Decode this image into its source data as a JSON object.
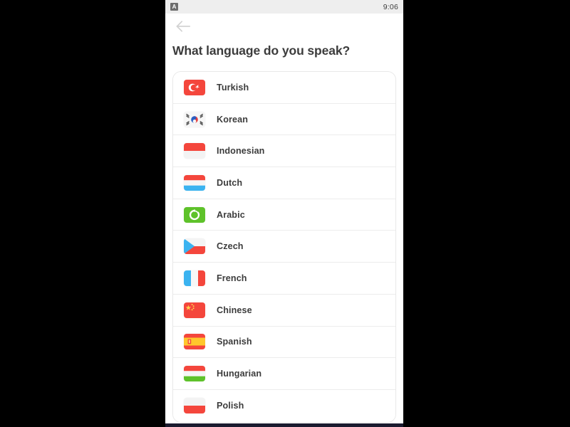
{
  "status_bar": {
    "app_icon": "app-badge-icon",
    "app_icon_glyph": "A",
    "time": "9:06"
  },
  "nav": {
    "back_icon": "back-arrow-icon"
  },
  "page": {
    "title": "What language do you speak?"
  },
  "colors": {
    "page_background": "#000000",
    "screen_background": "#ffffff",
    "status_bar_background": "#eeeeee",
    "text_primary": "#3c3c3c",
    "divider": "#ececec",
    "card_border": "#e8e8e8",
    "flag_red": "#f4463c",
    "flag_green": "#5ec22a",
    "flag_blue": "#3bb3f0",
    "flag_yellow": "#ffc72c"
  },
  "languages": [
    {
      "label": "Turkish",
      "flag": "flag-turkey-icon"
    },
    {
      "label": "Korean",
      "flag": "flag-south-korea-icon"
    },
    {
      "label": "Indonesian",
      "flag": "flag-indonesia-icon"
    },
    {
      "label": "Dutch",
      "flag": "flag-netherlands-icon"
    },
    {
      "label": "Arabic",
      "flag": "flag-arabic-icon"
    },
    {
      "label": "Czech",
      "flag": "flag-czech-republic-icon"
    },
    {
      "label": "French",
      "flag": "flag-france-icon"
    },
    {
      "label": "Chinese",
      "flag": "flag-china-icon"
    },
    {
      "label": "Spanish",
      "flag": "flag-spain-icon"
    },
    {
      "label": "Hungarian",
      "flag": "flag-hungary-icon"
    },
    {
      "label": "Polish",
      "flag": "flag-poland-icon"
    }
  ]
}
